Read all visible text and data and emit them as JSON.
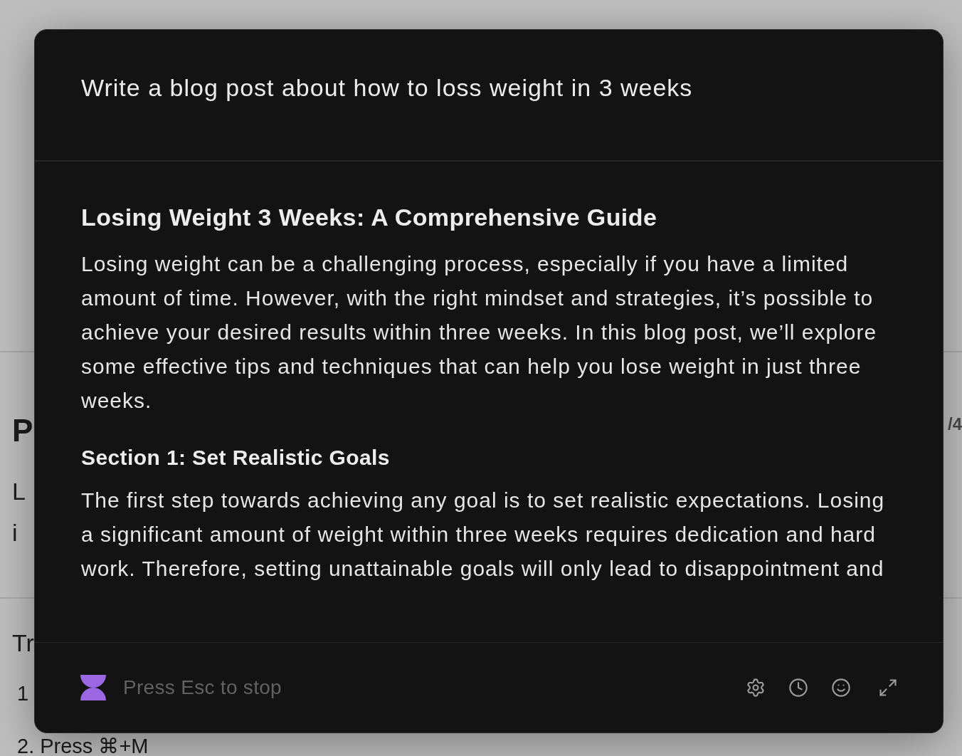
{
  "background": {
    "page_indicator": "/4",
    "heading": "P",
    "paragraph_lines": [
      "L",
      "i"
    ],
    "subheading": "Tr",
    "list_items": [
      "1",
      "2. Press ⌘+M"
    ]
  },
  "dialog": {
    "prompt": "Write a blog post about how to loss weight in 3 weeks",
    "response": [
      {
        "kind": "heading",
        "text": "Losing Weight 3 Weeks: A Comprehensive Guide"
      },
      {
        "kind": "paragraph",
        "text": "Losing weight can be a challenging process, especially if you have a limited amount of time. However, with the right mindset and strategies, it’s possible to achieve your desired results within three weeks. In this blog post, we’ll explore some effective tips and techniques that can help you lose weight in just three weeks."
      },
      {
        "kind": "subheading",
        "text": "Section 1: Set Realistic Goals"
      },
      {
        "kind": "paragraph",
        "text": "The first step towards achieving any goal is to set realistic expectations. Losing a significant amount of weight within three weeks requires dedication and hard work. Therefore, setting unattainable goals will only lead to disappointment and"
      }
    ],
    "footer": {
      "status": "Press Esc to stop"
    }
  }
}
